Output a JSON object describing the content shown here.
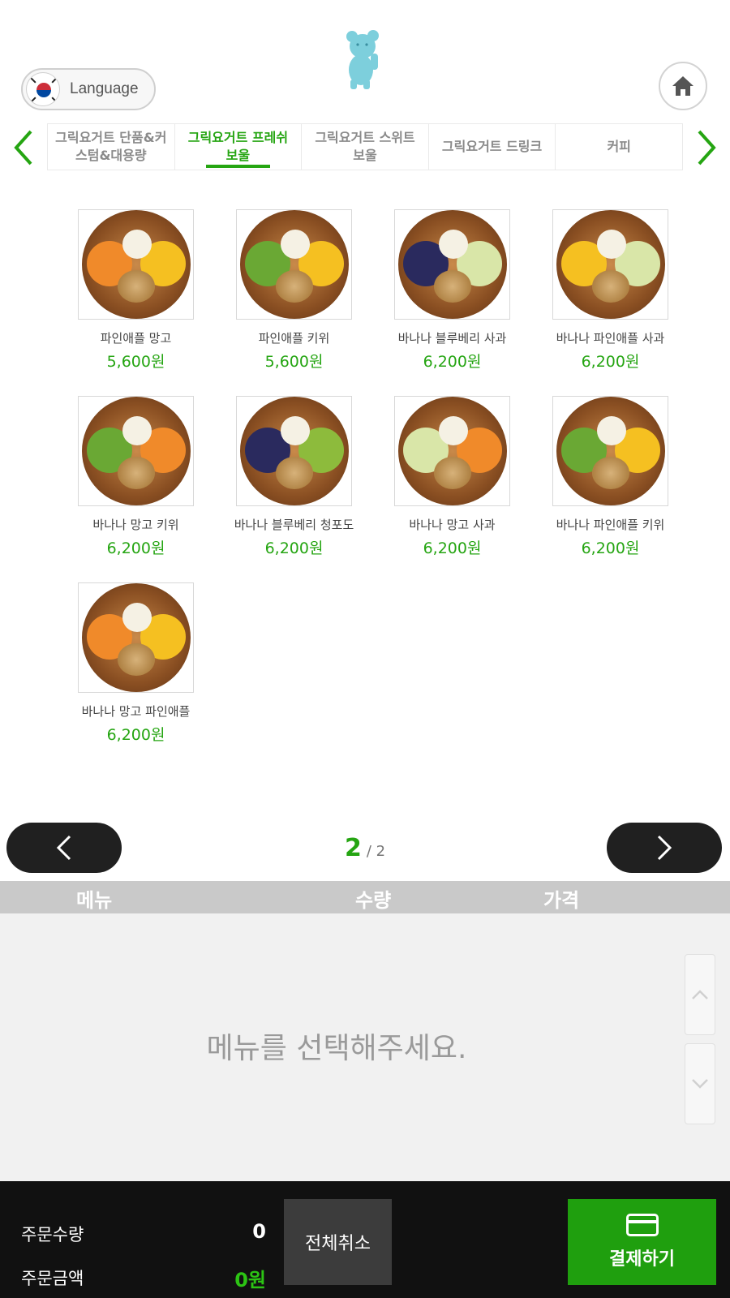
{
  "header": {
    "language_label": "Language"
  },
  "categories": [
    {
      "label": "그릭요거트 단품&커스텀&대용량",
      "active": false
    },
    {
      "label": "그릭요거트 프레쉬 보울",
      "active": true
    },
    {
      "label": "그릭요거트 스위트 보울",
      "active": false
    },
    {
      "label": "그릭요거트 드링크",
      "active": false
    },
    {
      "label": "커피",
      "active": false
    }
  ],
  "products": [
    {
      "name": "파인애플 망고",
      "price": "5,600원",
      "fruits": [
        "mango",
        "pineapple"
      ]
    },
    {
      "name": "파인애플 키위",
      "price": "5,600원",
      "fruits": [
        "kiwi",
        "pineapple"
      ]
    },
    {
      "name": "바나나 블루베리 사과",
      "price": "6,200원",
      "fruits": [
        "blueberry",
        "apple"
      ]
    },
    {
      "name": "바나나 파인애플 사과",
      "price": "6,200원",
      "fruits": [
        "pineapple",
        "apple"
      ]
    },
    {
      "name": "바나나 망고 키위",
      "price": "6,200원",
      "fruits": [
        "kiwi",
        "mango"
      ]
    },
    {
      "name": "바나나 블루베리 청포도",
      "price": "6,200원",
      "fruits": [
        "blueberry",
        "grape"
      ]
    },
    {
      "name": "바나나 망고 사과",
      "price": "6,200원",
      "fruits": [
        "apple",
        "mango"
      ]
    },
    {
      "name": "바나나 파인애플 키위",
      "price": "6,200원",
      "fruits": [
        "kiwi",
        "pineapple"
      ]
    },
    {
      "name": "바나나 망고 파인애플",
      "price": "6,200원",
      "fruits": [
        "mango",
        "pineapple"
      ]
    }
  ],
  "pagination": {
    "current": "2",
    "total": "/ 2"
  },
  "order_table": {
    "col_menu": "메뉴",
    "col_qty": "수량",
    "col_price": "가격",
    "empty_message": "메뉴를 선택해주세요."
  },
  "footer": {
    "qty_label": "주문수량",
    "qty_value": "0",
    "amount_label": "주문금액",
    "amount_value": "0원",
    "cancel_label": "전체취소",
    "pay_label": "결제하기"
  },
  "colors": {
    "accent": "#25a512",
    "footer_bg": "#111111",
    "pay_button": "#1f9f0e"
  }
}
